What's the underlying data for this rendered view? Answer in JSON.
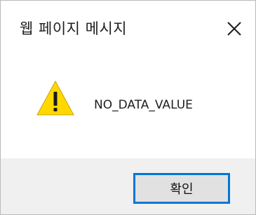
{
  "window": {
    "title": "웹 페이지 메시지"
  },
  "icons": {
    "close": "close-icon",
    "warning": "warning-icon"
  },
  "message": {
    "text": "NO_DATA_VALUE"
  },
  "buttons": {
    "ok_label": "확인"
  },
  "colors": {
    "warning_fill": "#ffd800",
    "warning_mark": "#1a1a1a",
    "focus_border": "#0078d7",
    "footer_background": "#f0f0f0"
  }
}
